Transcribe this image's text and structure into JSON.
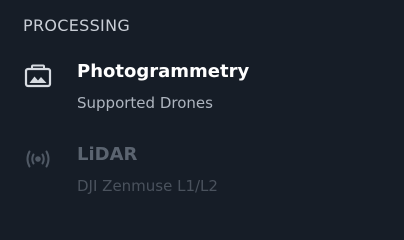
{
  "section": {
    "heading": "PROCESSING"
  },
  "items": [
    {
      "title": "Photogrammetry",
      "subtitle": "Supported Drones",
      "icon": "image-icon",
      "enabled": true
    },
    {
      "title": "LiDAR",
      "subtitle": "DJI Zenmuse L1/L2",
      "icon": "broadcast-icon",
      "enabled": false
    }
  ],
  "colors": {
    "background": "#161d27",
    "active_title": "#ffffff",
    "active_subtitle": "#aeb5bf",
    "disabled_title": "#5b6470",
    "disabled_subtitle": "#4a525d"
  }
}
